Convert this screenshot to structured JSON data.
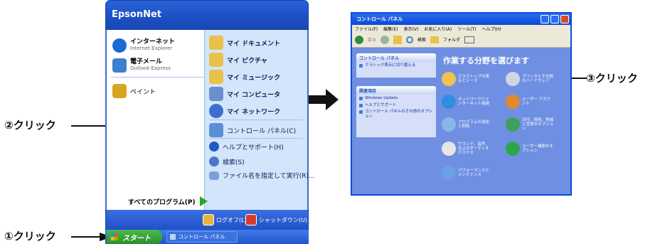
{
  "steps": {
    "step1": "①クリック",
    "step2": "②クリック",
    "step3": "③クリック"
  },
  "start_menu": {
    "user_name": "EpsonNet",
    "pinned": [
      {
        "title": "インターネット",
        "subtitle": "Internet Explorer",
        "icon": "ie-icon",
        "color": "#1c69d6"
      },
      {
        "title": "電子メール",
        "subtitle": "Outlook Express",
        "icon": "mail-icon",
        "color": "#3d7fcf"
      }
    ],
    "recent": [
      {
        "title": "ペイント",
        "icon": "paint-icon",
        "color": "#d8a523"
      }
    ],
    "right_items": [
      {
        "label": "マイ ドキュメント",
        "icon": "folder-icon",
        "color": "#e8c24a",
        "bold": true
      },
      {
        "label": "マイ ピクチャ",
        "icon": "folder-icon",
        "color": "#e8c24a",
        "bold": true
      },
      {
        "label": "マイ ミュージック",
        "icon": "folder-icon",
        "color": "#e8c24a",
        "bold": true
      },
      {
        "label": "マイ コンピュータ",
        "icon": "computer-icon",
        "color": "#6a8fcf",
        "bold": true
      },
      {
        "label": "マイ ネットワーク",
        "icon": "network-icon",
        "color": "#3a6fd0",
        "bold": true
      },
      {
        "label": "コントロール パネル(C)",
        "icon": "control-panel-icon",
        "color": "#5b8ed6",
        "bold": false
      },
      {
        "label": "ヘルプとサポート(H)",
        "icon": "help-icon",
        "color": "#2357c9",
        "bold": false
      },
      {
        "label": "検索(S)",
        "icon": "search-icon",
        "color": "#4a77cf",
        "bold": false
      },
      {
        "label": "ファイル名を指定して実行(R)...",
        "icon": "run-icon",
        "color": "#7a9fd9",
        "bold": false
      }
    ],
    "all_programs": "すべてのプログラム(P)",
    "logoff": "ログオフ(L)",
    "shutdown": "シャットダウン(U)"
  },
  "taskbar": {
    "start_label": "スタート",
    "task_item": "コントロール パネル"
  },
  "control_panel": {
    "title": "コントロール パネル",
    "menu": [
      "ファイル(F)",
      "編集(E)",
      "表示(V)",
      "お気に入り(A)",
      "ツール(T)",
      "ヘルプ(H)"
    ],
    "toolbar": {
      "back": "戻る",
      "search": "検索",
      "folders": "フォルダ"
    },
    "side_panel_title": "コントロール パネル",
    "side_panel_link": "クラシック表示に切り替える",
    "related_title": "関連項目",
    "related_links": [
      "Windows Update",
      "ヘルプとサポート",
      "コントロール パネルのその他のオプション"
    ],
    "heading": "作業する分野を選びます",
    "categories": [
      {
        "label": "デスクトップの表示とテーマ",
        "icon": "desktop-icon",
        "color": "#f2c14e"
      },
      {
        "label": "プリンタとその他のハードウェア",
        "icon": "printer-icon",
        "color": "#cfd6e2"
      },
      {
        "label": "ネットワークとインターネット接続",
        "icon": "network-globe-icon",
        "color": "#2f8ee3"
      },
      {
        "label": "ユーザー アカウント",
        "icon": "users-icon",
        "color": "#e08a2e"
      },
      {
        "label": "プログラムの追加と削除",
        "icon": "programs-icon",
        "color": "#8ab6ea"
      },
      {
        "label": "日付、時刻、地域と言語のオプション",
        "icon": "globe-icon",
        "color": "#3ea05a"
      },
      {
        "label": "サウンド、音声、およびオーディオ デバイス",
        "icon": "sound-icon",
        "color": "#e6e6e6"
      },
      {
        "label": "ユーザー補助のオプション",
        "icon": "accessibility-icon",
        "color": "#2da64a"
      },
      {
        "label": "パフォーマンスとメンテナンス",
        "icon": "performance-icon",
        "color": "#6aa0e6"
      }
    ]
  }
}
